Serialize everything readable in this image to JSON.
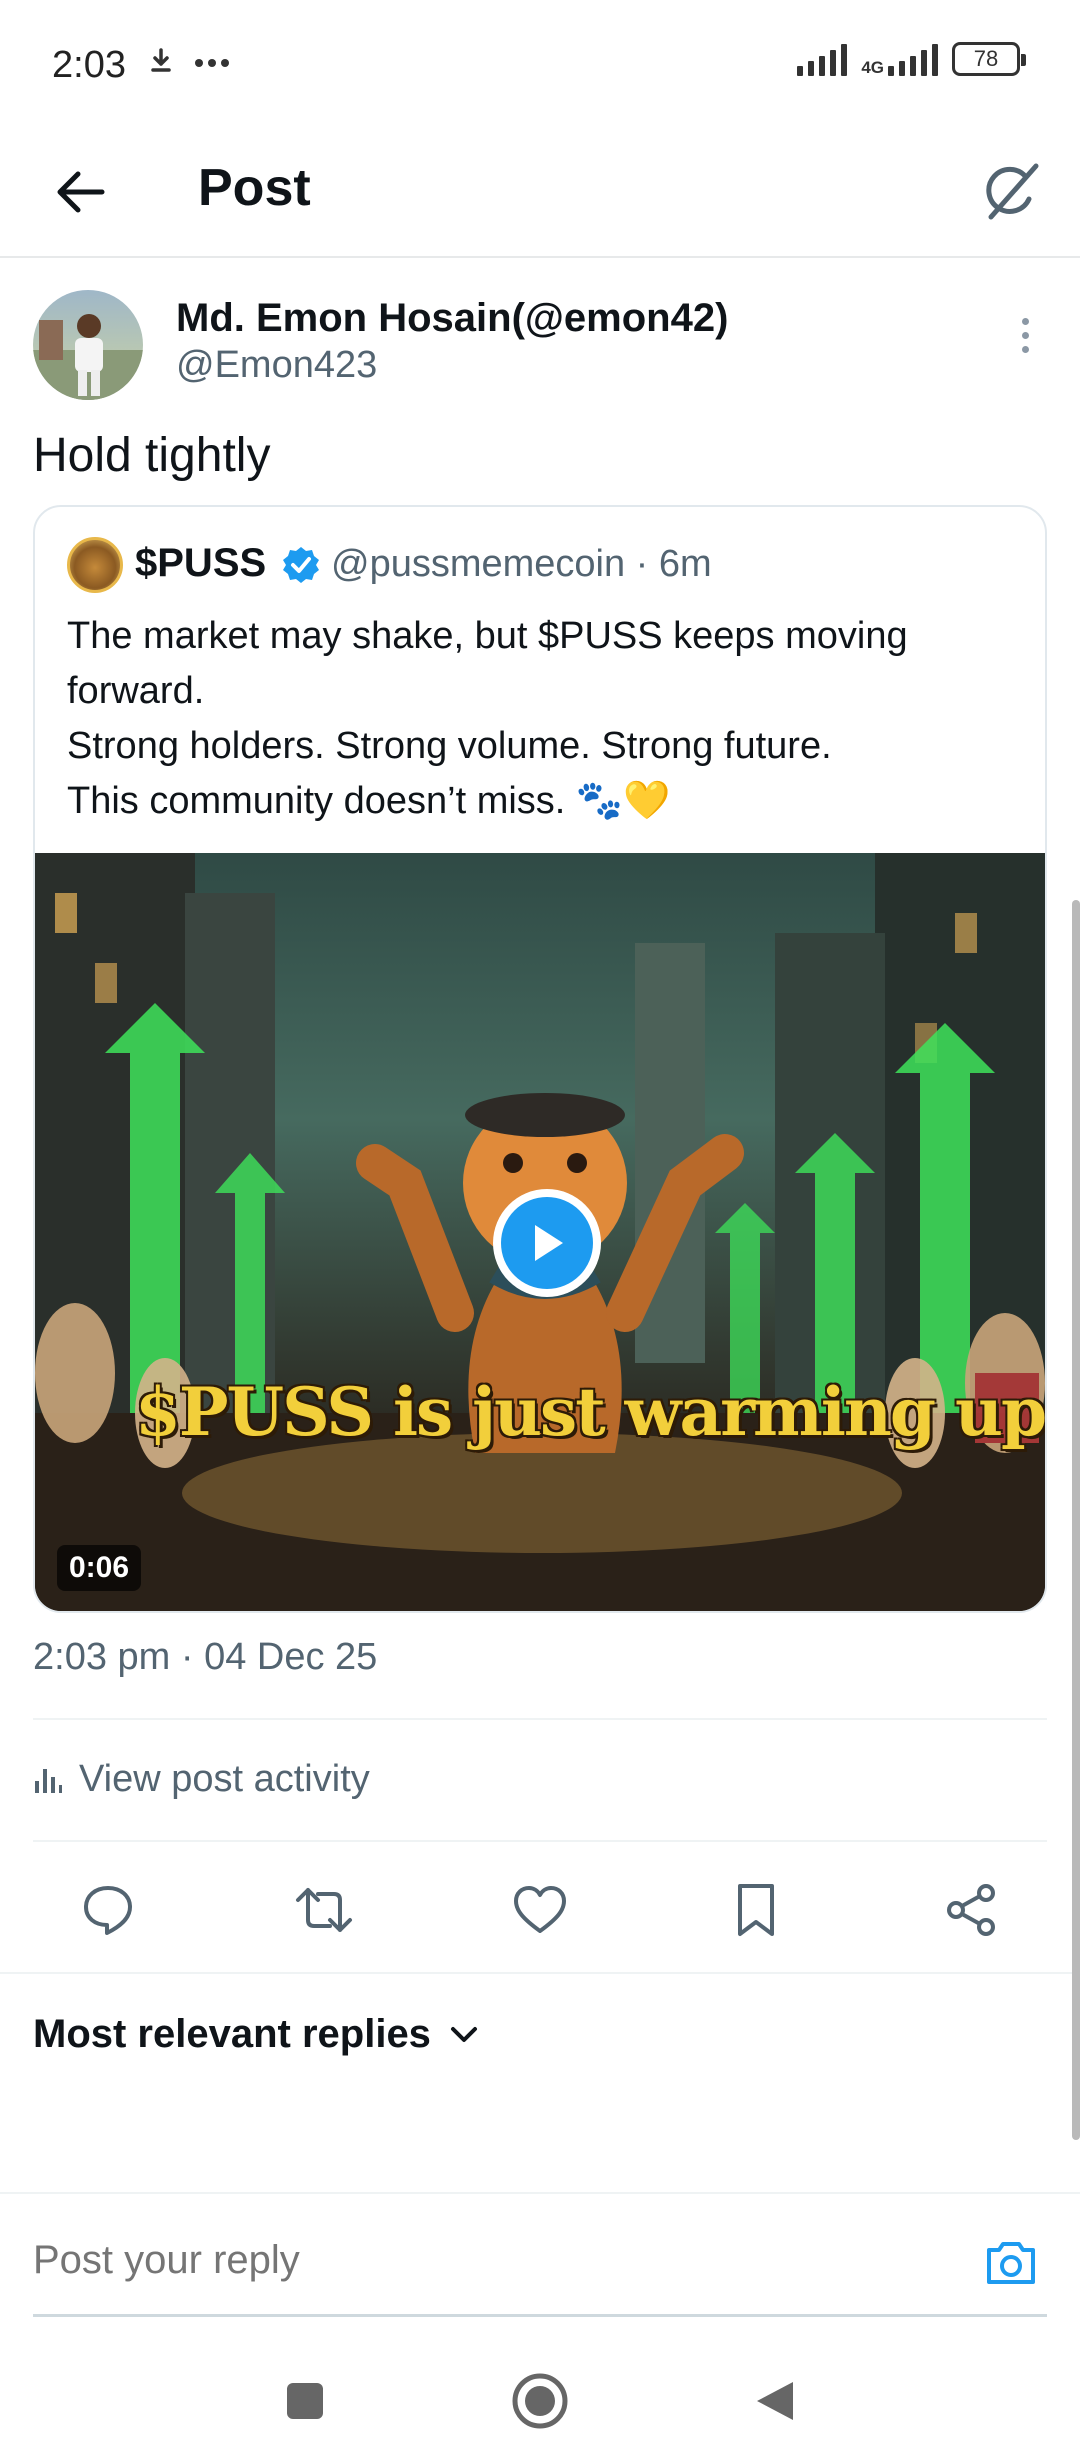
{
  "status_bar": {
    "time": "2:03",
    "network": "4G",
    "battery": "78",
    "download_icon": "download-icon",
    "more_icon": "more-dots-icon"
  },
  "header": {
    "title": "Post",
    "back_icon": "arrow-left-icon",
    "grok_icon": "grok-icon"
  },
  "post": {
    "author_name": "Md. Emon Hosain(@emon42)",
    "author_handle": "@Emon423",
    "text": "Hold tightly",
    "timestamp": "2:03 pm · 04 Dec 25"
  },
  "quote": {
    "name": "$PUSS",
    "handle_time": "@pussmemecoin · 6m",
    "lines": [
      "The market may shake, but $PUSS keeps moving forward.",
      "Strong holders. Strong volume. Strong future.",
      "This community doesn’t miss. 🐾💛"
    ],
    "media": {
      "caption": "$PUSS is just warming up",
      "duration": "0:06"
    }
  },
  "activity": {
    "label": "View post activity"
  },
  "actions": [
    "reply-icon",
    "repost-icon",
    "like-icon",
    "bookmark-icon",
    "share-icon"
  ],
  "replies": {
    "sort_label": "Most relevant replies"
  },
  "reply_box": {
    "placeholder": "Post your reply"
  },
  "colors": {
    "accent": "#1d9bf0",
    "text": "#0f1419",
    "secondary": "#536471",
    "divider": "#eff3f4"
  }
}
